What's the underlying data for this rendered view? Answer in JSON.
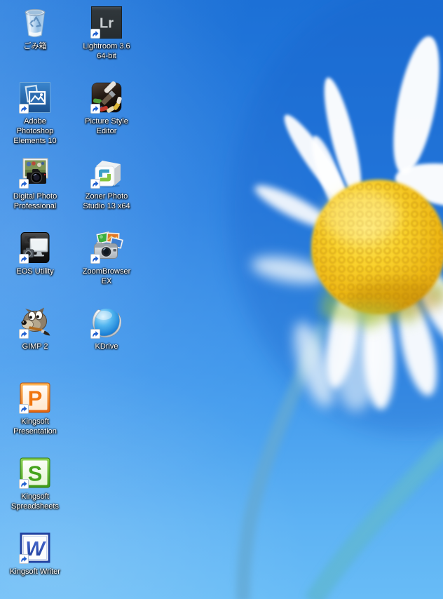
{
  "desktop": {
    "wallpaper": {
      "name": "windows-8-daisy",
      "description": "Blurred white daisy with yellow floret center on a blue sky, two soft stems crossing the lower right",
      "colors": {
        "sky_top": "#1d72d8",
        "sky_bottom": "#66bbf6",
        "flower_center": "#f3c51d",
        "petals": "#ffffff",
        "stems": "#5fadd6"
      }
    },
    "icons": [
      {
        "label": "ごみ箱",
        "name": "recycle-bin",
        "shortcut": false
      },
      {
        "label": "Lightroom 3.6 64-bit",
        "name": "lightroom",
        "shortcut": true,
        "glyph": "Lr"
      },
      {
        "label": "Adobe Photoshop Elements 10",
        "name": "adobe-photoshop-elements-10",
        "shortcut": true
      },
      {
        "label": "Picture Style Editor",
        "name": "picture-style-editor",
        "shortcut": true
      },
      {
        "label": "Digital Photo Professional",
        "name": "digital-photo-professional",
        "shortcut": true
      },
      {
        "label": "Zoner Photo Studio 13 x64",
        "name": "zoner-photo-studio-13-x64",
        "shortcut": true
      },
      {
        "label": "EOS Utility",
        "name": "eos-utility",
        "shortcut": true
      },
      {
        "label": "ZoomBrowser EX",
        "name": "zoombrowser-ex",
        "shortcut": true
      },
      {
        "label": "GIMP 2",
        "name": "gimp-2",
        "shortcut": true
      },
      {
        "label": "KDrive",
        "name": "kdrive",
        "shortcut": true
      },
      {
        "label": "Kingsoft Presentation",
        "name": "kingsoft-presentation",
        "shortcut": true,
        "glyph": "P"
      },
      {
        "label": "Kingsoft Spreadsheets",
        "name": "kingsoft-spreadsheets",
        "shortcut": true,
        "glyph": "S"
      },
      {
        "label": "Kingsoft Writer",
        "name": "kingsoft-writer",
        "shortcut": true,
        "glyph": "W"
      }
    ]
  }
}
